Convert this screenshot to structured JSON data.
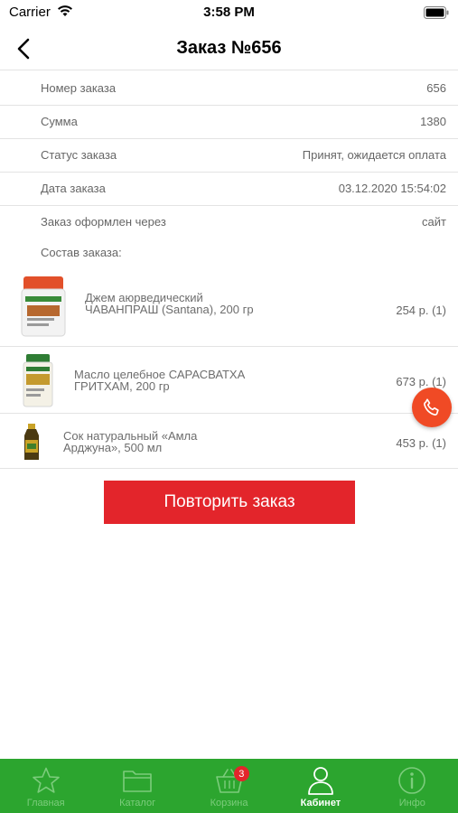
{
  "status_bar": {
    "carrier": "Carrier",
    "time": "3:58 PM"
  },
  "nav": {
    "title": "Заказ №656"
  },
  "info": [
    {
      "label": "Номер заказа",
      "value": "656"
    },
    {
      "label": "Сумма",
      "value": "1380"
    },
    {
      "label": "Статус заказа",
      "value": "Принят, ожидается оплата"
    },
    {
      "label": "Дата заказа",
      "value": "03.12.2020 15:54:02"
    },
    {
      "label": "Заказ оформлен через",
      "value": "сайт"
    }
  ],
  "composition_label": "Состав заказа:",
  "products": [
    {
      "name": "Джем аюрведический ЧАВАНПРАШ (Santana), 200 гр",
      "price": "254 р. (1)"
    },
    {
      "name": "Масло целебное САРАСВАТХА ГРИТХАМ, 200 гр",
      "price": "673 р. (1)"
    },
    {
      "name": "Сок натуральный «Амла Арджуна», 500 мл",
      "price": "453 р. (1)"
    }
  ],
  "repeat_button": "Повторить заказ",
  "tabs": [
    {
      "label": "Главная",
      "icon": "star-icon"
    },
    {
      "label": "Каталог",
      "icon": "folder-icon"
    },
    {
      "label": "Корзина",
      "icon": "basket-icon",
      "badge": "3"
    },
    {
      "label": "Кабинет",
      "icon": "user-icon",
      "active": true
    },
    {
      "label": "Инфо",
      "icon": "info-icon"
    }
  ],
  "colors": {
    "accent_red": "#e3252b",
    "tab_green": "#2ca52f",
    "call_orange": "#f04a25"
  }
}
